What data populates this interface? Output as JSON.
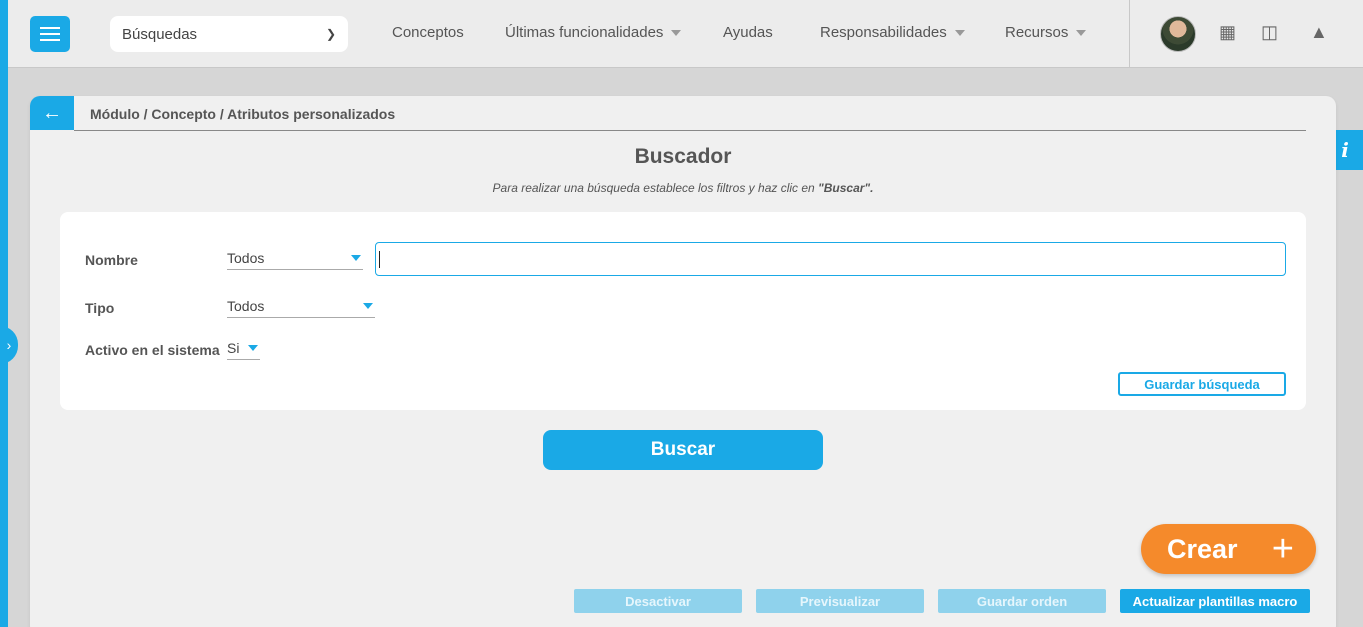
{
  "header": {
    "search_select": "Búsquedas",
    "nav": [
      {
        "label": "Conceptos",
        "has_caret": false
      },
      {
        "label": "Últimas funcionalidades",
        "has_caret": true
      },
      {
        "label": "Ayudas",
        "has_caret": false
      },
      {
        "label": "Responsabilidades",
        "has_caret": true
      },
      {
        "label": "Recursos",
        "has_caret": true
      }
    ],
    "icons": [
      "calendar-icon",
      "map-icon",
      "bell-icon"
    ]
  },
  "breadcrumb": "Módulo / Concepto / Atributos personalizados",
  "title": "Buscador",
  "subtitle_prefix": "Para realizar una búsqueda establece los filtros y haz clic en ",
  "subtitle_strong": "\"Buscar\".",
  "form": {
    "nombre_label": "Nombre",
    "nombre_mode": "Todos",
    "nombre_value": "",
    "tipo_label": "Tipo",
    "tipo_value": "Todos",
    "activo_label": "Activo en el sistema",
    "activo_value": "Si",
    "save_search": "Guardar búsqueda"
  },
  "buscar": "Buscar",
  "crear": "Crear",
  "bottom_buttons": [
    {
      "label": "Desactivar",
      "enabled": false
    },
    {
      "label": "Previsualizar",
      "enabled": false
    },
    {
      "label": "Guardar orden",
      "enabled": false
    },
    {
      "label": "Actualizar plantillas macro",
      "enabled": true
    }
  ],
  "info_tab": "i",
  "colors": {
    "accent": "#1aa9e6",
    "create": "#f58a2b"
  }
}
